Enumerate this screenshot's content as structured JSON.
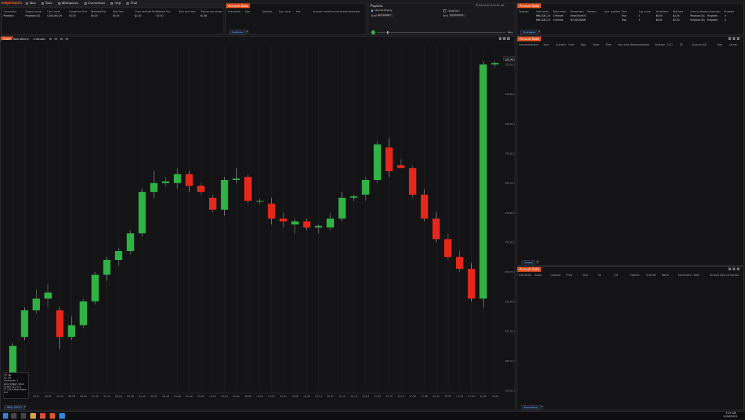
{
  "app": {
    "logo": "NINJATRADER",
    "menu": [
      "New",
      "Tools",
      "Workspaces",
      "Connections",
      "Help",
      "Chat"
    ]
  },
  "account_top": {
    "headers": [
      "Connection",
      "Display name",
      "Cash value",
      "Unrealized ProL",
      "Realized ProL",
      "Total ProL",
      "Gross realized ProL",
      "Weekly ProL",
      "Daily loss limit",
      "Trailing max drawdown"
    ],
    "row": [
      "Playback",
      "Playback101",
      "$100,000.00",
      "$0.00",
      "$0.00",
      "$0.00",
      "$0.00",
      "$0.00",
      "",
      "$0.00"
    ]
  },
  "positions_panel": {
    "title": "Account Data",
    "headers": [
      "Instrument",
      "Side",
      "Quantity",
      "Avg. price",
      "ProL",
      "Account name",
      "Account display",
      "Connection"
    ],
    "tab": "Positions"
  },
  "playback": {
    "title": "Playback",
    "mode_market": "Market Replay",
    "mode_historical": "Historical",
    "start_label": "Start",
    "start_value": "10/16/2025",
    "end_label": "End",
    "end_value": "10/29/2025",
    "time": "10/16/2025 9:29:55 AM",
    "speed": "Max"
  },
  "strategies_panel": {
    "title": "Account Data",
    "headers": [
      "Strategy",
      "Instrument",
      "Data series",
      "Parameters",
      "Position",
      "Acct. position",
      "Sync",
      "Avg. price",
      "Unrealized",
      "Realized",
      "Account display",
      "Connection",
      "Enabled"
    ],
    "rows": [
      [
        "",
        "MNQ DEC25",
        "1 Minute",
        "False/True/0/1",
        "",
        "",
        "True",
        "0",
        "$0.00",
        "$0.00",
        "Playback101",
        "Playback",
        "✔"
      ],
      [
        "",
        "MNQ DEC25",
        "1 Minute",
        "NTO@Q/DAW",
        "",
        "",
        "True",
        "0",
        "$0.00",
        "$0.00",
        "Playback101",
        "Playback",
        "✔"
      ]
    ],
    "tab": "Strategies"
  },
  "orders_panel": {
    "title": "Account Data",
    "headers": [
      "Instrument",
      "Action",
      "Type",
      "Quantity",
      "Limit",
      "Stop",
      "State",
      "Filled",
      "Avg. price",
      "Remaining",
      "Name",
      "Strategy",
      "OCO",
      "TIF",
      "Account d",
      "ID",
      "Time",
      "Cancel"
    ],
    "tab": "Orders"
  },
  "executions_panel": {
    "title": "Account Data",
    "headers": [
      "Instrument",
      "Action",
      "Quantity",
      "Price",
      "Time",
      "ID",
      "E/X",
      "Position",
      "Order ID",
      "Name",
      "Commission",
      "Rate",
      "Account disp",
      "Connection"
    ],
    "tab": "Executions"
  },
  "chart_window": {
    "title": "Chart",
    "instrument": "MNQ DEC25",
    "interval": "1 Minute",
    "indicator_line": "SMA(MNQ DEC25 (1 Minute),14) NTOQLOC(DAW-SAI, 6 CF)",
    "info_box": [
      "TP: $0",
      "SL: $0",
      "Contracts: 1",
      "Anti Hedge: False",
      "CHBO v1.2.0.3",
      "© 2025 NinjaTrader LLC"
    ],
    "bottom_tab": "MNQ DEC25",
    "last_price_label": "25176.00"
  },
  "chart_data": {
    "type": "candlestick",
    "times": [
      "09:11",
      "09:20",
      "09:22",
      "09:24",
      "09:26",
      "09:28",
      "09:30",
      "09:32",
      "09:34",
      "09:36",
      "09:38",
      "09:40",
      "09:42",
      "09:44",
      "09:46",
      "09:48",
      "09:50",
      "09:52",
      "09:54",
      "09:56",
      "09:58",
      "10:00",
      "10:02",
      "10:04",
      "10:06",
      "10:08",
      "10:10",
      "10:12",
      "10:14",
      "10:16",
      "10:18",
      "10:20",
      "10:22",
      "10:24",
      "10:26",
      "10:28",
      "10:30",
      "10:32",
      "10:34",
      "10:36",
      "10:38",
      "10:40"
    ],
    "candles": [
      {
        "o": 25105,
        "h": 25116,
        "l": 25100,
        "c": 25115
      },
      {
        "o": 25118,
        "h": 25128,
        "l": 25117,
        "c": 25127
      },
      {
        "o": 25127,
        "h": 25134,
        "l": 25126,
        "c": 25131
      },
      {
        "o": 25131,
        "h": 25136,
        "l": 25128,
        "c": 25133
      },
      {
        "o": 25127,
        "h": 25128,
        "l": 25114,
        "c": 25118
      },
      {
        "o": 25118,
        "h": 25125,
        "l": 25117,
        "c": 25122
      },
      {
        "o": 25122,
        "h": 25131,
        "l": 25121,
        "c": 25130
      },
      {
        "o": 25130,
        "h": 25140,
        "l": 25129,
        "c": 25139
      },
      {
        "o": 25139,
        "h": 25145,
        "l": 25137,
        "c": 25144
      },
      {
        "o": 25144,
        "h": 25148,
        "l": 25142,
        "c": 25147
      },
      {
        "o": 25147,
        "h": 25154,
        "l": 25146,
        "c": 25153
      },
      {
        "o": 25153,
        "h": 25168,
        "l": 25152,
        "c": 25167
      },
      {
        "o": 25167,
        "h": 25174,
        "l": 25165,
        "c": 25170
      },
      {
        "o": 25170,
        "h": 25172,
        "l": 25169,
        "c": 25170.5
      },
      {
        "o": 25170,
        "h": 25175,
        "l": 25168,
        "c": 25173
      },
      {
        "o": 25173,
        "h": 25174,
        "l": 25167,
        "c": 25169
      },
      {
        "o": 25169,
        "h": 25170,
        "l": 25166,
        "c": 25167
      },
      {
        "o": 25165,
        "h": 25166,
        "l": 25160,
        "c": 25161
      },
      {
        "o": 25161,
        "h": 25172,
        "l": 25159,
        "c": 25171
      },
      {
        "o": 25171,
        "h": 25175,
        "l": 25170,
        "c": 25171.5
      },
      {
        "o": 25172,
        "h": 25173,
        "l": 25163,
        "c": 25164
      },
      {
        "o": 25164,
        "h": 25164.5,
        "l": 25163,
        "c": 25164
      },
      {
        "o": 25163,
        "h": 25165,
        "l": 25156,
        "c": 25158
      },
      {
        "o": 25158,
        "h": 25160,
        "l": 25155,
        "c": 25157
      },
      {
        "o": 25156,
        "h": 25158,
        "l": 25153,
        "c": 25157
      },
      {
        "o": 25157,
        "h": 25158,
        "l": 25154,
        "c": 25155
      },
      {
        "o": 25155,
        "h": 25156,
        "l": 25153,
        "c": 25155.5
      },
      {
        "o": 25155,
        "h": 25160,
        "l": 25154,
        "c": 25158
      },
      {
        "o": 25158,
        "h": 25167,
        "l": 25157,
        "c": 25165
      },
      {
        "o": 25165,
        "h": 25166,
        "l": 25164,
        "c": 25165.5
      },
      {
        "o": 25166,
        "h": 25172,
        "l": 25164,
        "c": 25171
      },
      {
        "o": 25171,
        "h": 25184,
        "l": 25170,
        "c": 25183
      },
      {
        "o": 25182,
        "h": 25185,
        "l": 25172,
        "c": 25174
      },
      {
        "o": 25176,
        "h": 25178,
        "l": 25175,
        "c": 25175
      },
      {
        "o": 25175,
        "h": 25176,
        "l": 25165,
        "c": 25166
      },
      {
        "o": 25166,
        "h": 25168,
        "l": 25157,
        "c": 25158
      },
      {
        "o": 25158,
        "h": 25160,
        "l": 25150,
        "c": 25151
      },
      {
        "o": 25151,
        "h": 25153,
        "l": 25144,
        "c": 25145
      },
      {
        "o": 25145,
        "h": 25147,
        "l": 25140,
        "c": 25141
      },
      {
        "o": 25141,
        "h": 25143,
        "l": 25130,
        "c": 25131
      },
      {
        "o": 25131,
        "h": 25211,
        "l": 25128,
        "c": 25210
      },
      {
        "o": 25210,
        "h": 25211,
        "l": 25209,
        "c": 25210.5
      }
    ],
    "price_axis": [
      "25176.00",
      "25210.00",
      "25200.00",
      "25190.00",
      "25180.00",
      "25170.00",
      "25160.00",
      "25150.00",
      "25140.00",
      "25130.00",
      "25120.00",
      "25110.00",
      "25100.00"
    ],
    "ylim": [
      25100,
      25215
    ],
    "colors": {
      "up": "#2fb344",
      "down": "#e8271b",
      "wick": "#8a8a8a",
      "grid": "#232327",
      "bg": "#141416"
    }
  },
  "taskbar": {
    "clock": "9:29 AM",
    "date": "10/16/2025"
  }
}
